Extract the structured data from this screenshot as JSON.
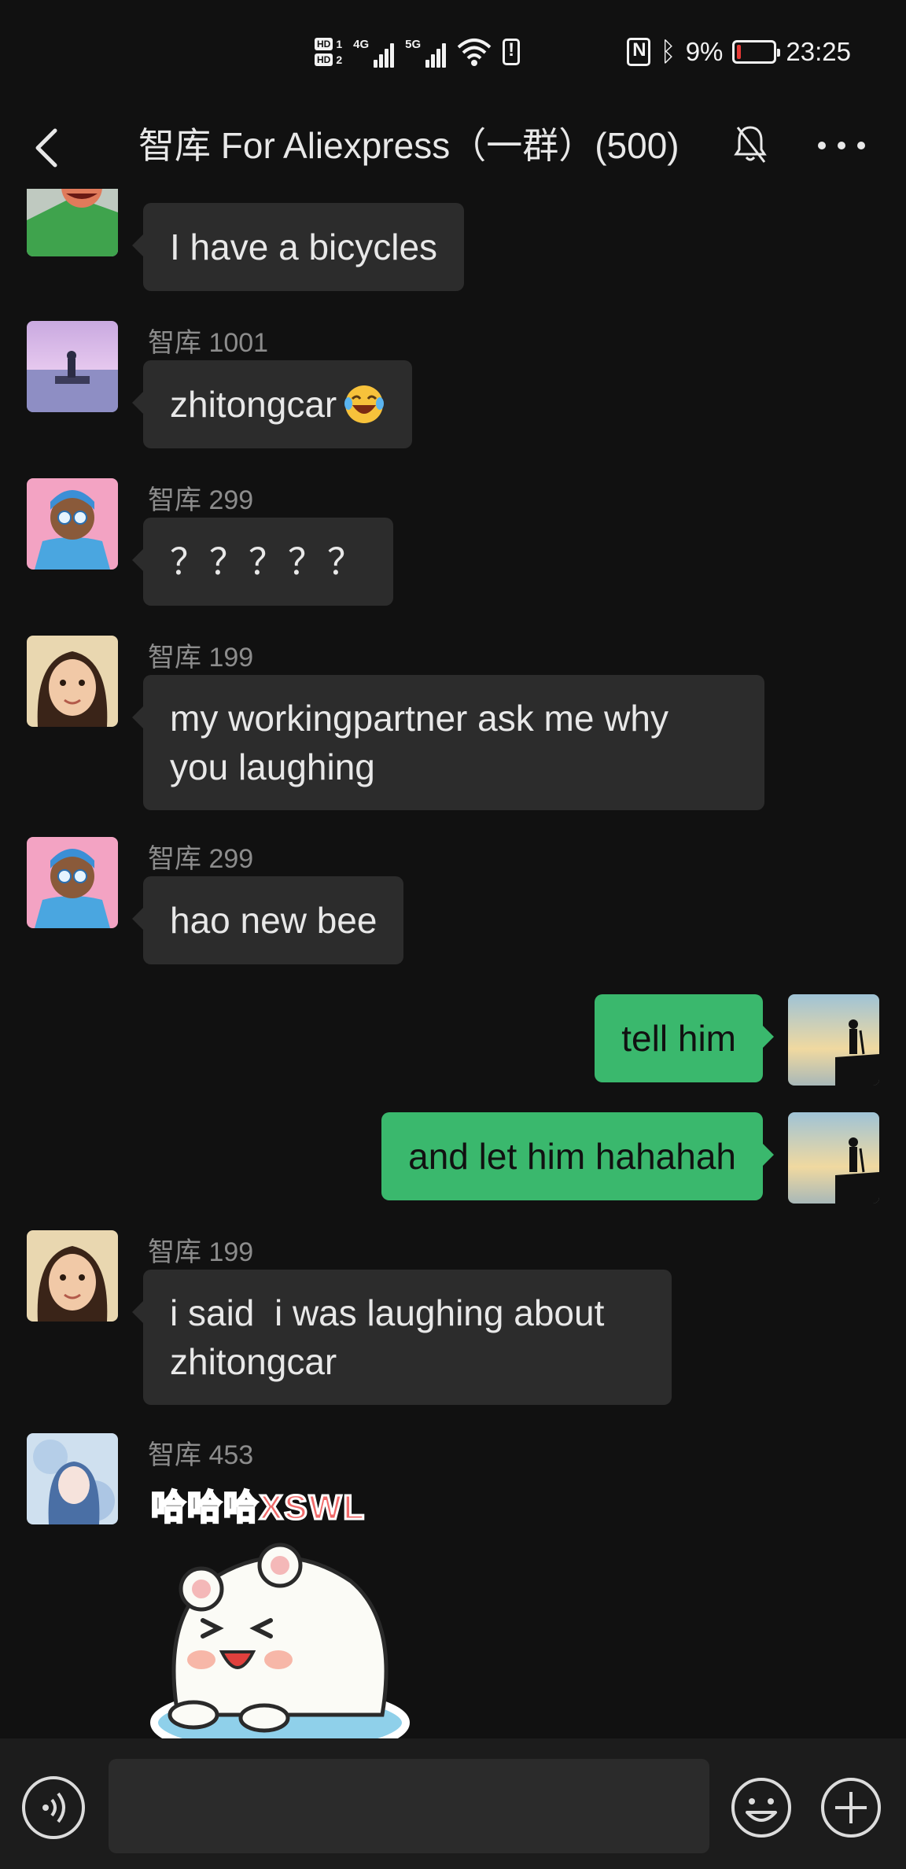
{
  "status_bar": {
    "hd_labels": [
      "HD",
      "HD"
    ],
    "sim_numbers": [
      "1",
      "2"
    ],
    "network_tags": [
      "4G",
      "5G"
    ],
    "battery_percent": "9%",
    "battery_level": 0.09,
    "time": "23:25",
    "icons": [
      "signal-icon",
      "wifi-icon",
      "alert-icon",
      "nfc-icon",
      "bluetooth-icon",
      "battery-icon"
    ]
  },
  "nav": {
    "title": "智库 For Aliexpress（一群）(500)",
    "icons": [
      "back-icon",
      "mute-icon",
      "more-icon"
    ]
  },
  "messages": [
    {
      "sender": "",
      "text": "I have a bicycles",
      "avatar": "cartoon-avatar"
    },
    {
      "sender": "智库 1001",
      "text": "zhitongcar",
      "emoji": "laughing-tears-emoji",
      "avatar": "lake-pier-avatar"
    },
    {
      "sender": "智库 299",
      "text": "？？？？？",
      "avatar": "blue-cartoon-avatar"
    },
    {
      "sender": "智库 199",
      "lines": [
        "my workingpartner ask me why",
        "you laughing"
      ],
      "avatar": "child-photo-avatar"
    },
    {
      "sender": "智库 299",
      "text": "hao new bee",
      "avatar": "blue-cartoon-avatar"
    },
    {
      "sender": "self",
      "text": "tell him",
      "avatar": "hiker-sunset-avatar"
    },
    {
      "sender": "self",
      "text": "and let him hahahah",
      "avatar": "hiker-sunset-avatar"
    },
    {
      "sender": "智库 199",
      "lines": [
        "i said  i was laughing about",
        "zhitongcar"
      ],
      "avatar": "child-photo-avatar"
    },
    {
      "sender": "智库 453",
      "sticker_text": "哈哈哈XSWL",
      "sticker": "laughing-bear-sticker",
      "avatar": "anime-girl-avatar"
    }
  ],
  "input_bar": {
    "placeholder": "",
    "icons": [
      "voice-icon",
      "emoji-icon",
      "plus-icon"
    ]
  },
  "colors": {
    "background": "#111111",
    "bubble_other": "#2c2c2c",
    "bubble_self": "#3ab86d",
    "sender_text": "#8c8c8c"
  }
}
